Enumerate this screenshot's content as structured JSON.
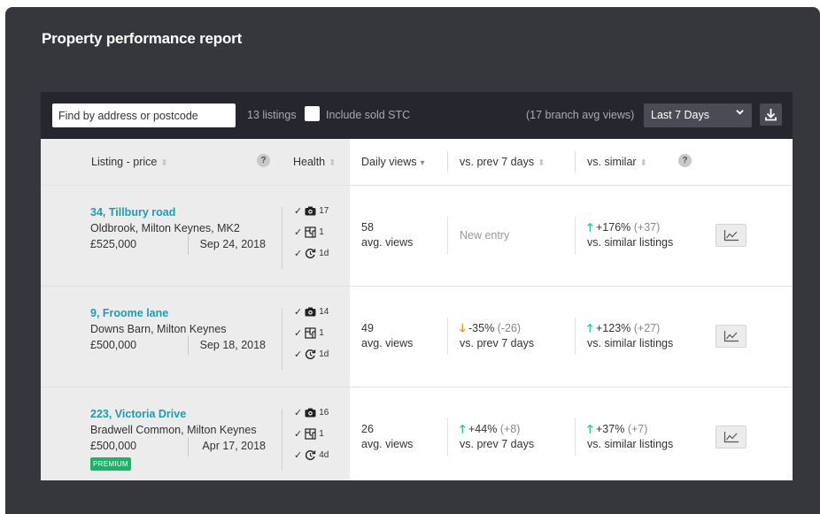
{
  "title": "Property performance report",
  "toolbar": {
    "search_placeholder": "Find by address or postcode",
    "listings_count": "13 listings",
    "include_sold_label": "Include sold STC",
    "branch_avg": "(17 branch avg views)",
    "period_selected": "Last 7 Days"
  },
  "headers": {
    "listing_price": "Listing - price",
    "health": "Health",
    "daily_views": "Daily views",
    "vs_prev": "vs. prev 7 days",
    "vs_similar": "vs. similar",
    "help": "?"
  },
  "rows": [
    {
      "address": "34, Tillbury road",
      "area": "Oldbrook, Milton Keynes, MK2",
      "price": "£525,000",
      "date": "Sep 24, 2018",
      "badge": "",
      "photos": "17",
      "floorplans": "1",
      "updated": "1d",
      "daily_views": "58",
      "views_unit": "avg. views",
      "prev_text": "New entry",
      "prev_pct": "",
      "prev_delta": "",
      "prev_label": "",
      "similar_pct": "+176%",
      "similar_delta": "(+37)",
      "similar_label": "vs. similar listings"
    },
    {
      "address": "9, Froome lane",
      "area": "Downs Barn, Milton Keynes",
      "price": "£500,000",
      "date": "Sep 18, 2018",
      "badge": "",
      "photos": "14",
      "floorplans": "1",
      "updated": "1d",
      "daily_views": "49",
      "views_unit": "avg. views",
      "prev_text": "",
      "prev_pct": "-35%",
      "prev_delta": "(-26)",
      "prev_label": "vs. prev 7 days",
      "similar_pct": "+123%",
      "similar_delta": "(+27)",
      "similar_label": "vs. similar listings"
    },
    {
      "address": "223, Victoria Drive",
      "area": "Bradwell Common, Milton Keynes",
      "price": "£500,000",
      "date": "Apr 17, 2018",
      "badge": "PREMIUM",
      "photos": "16",
      "floorplans": "1",
      "updated": "4d",
      "daily_views": "26",
      "views_unit": "avg. views",
      "prev_text": "",
      "prev_pct": "+44%",
      "prev_delta": "(+8)",
      "prev_label": "vs. prev 7 days",
      "similar_pct": "+37%",
      "similar_delta": "(+7)",
      "similar_label": "vs. similar listings"
    }
  ],
  "colors": {
    "frame_bg": "#36363d",
    "toolbar_bg": "#26262e",
    "link": "#17a0b5",
    "up": "#19c4a0",
    "down": "#f08a1e",
    "premium": "#19b36a"
  }
}
